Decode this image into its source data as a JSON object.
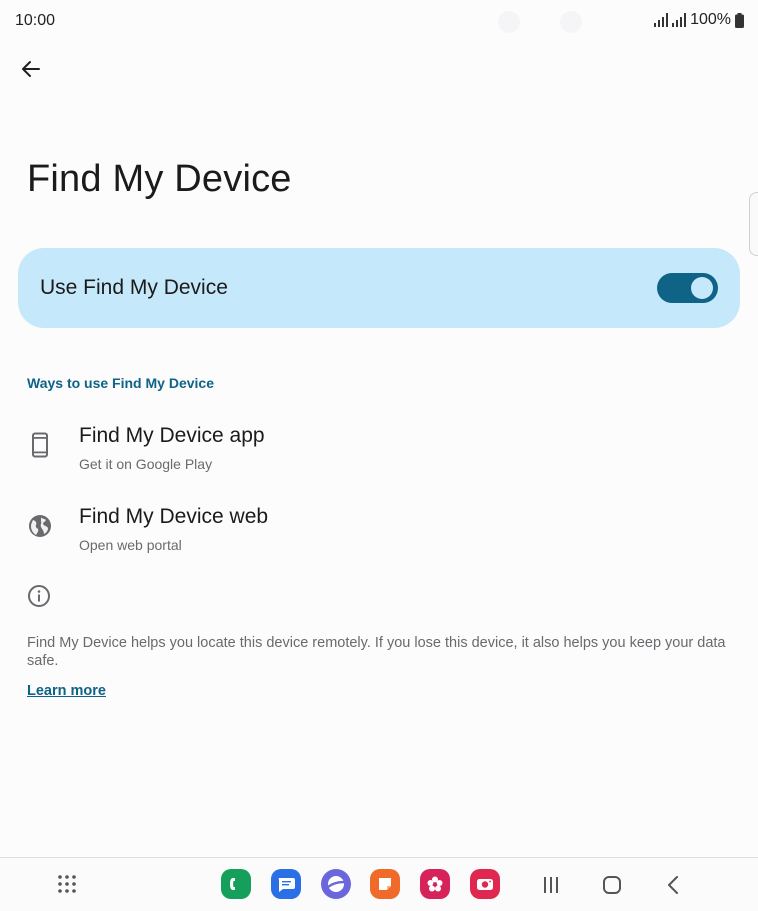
{
  "status_bar": {
    "time": "10:00",
    "battery": "100%",
    "icons": [
      "signal-icon",
      "signal-icon",
      "battery-icon"
    ]
  },
  "header": {
    "back_icon": "arrow-back-icon"
  },
  "page": {
    "title": "Find My Device"
  },
  "main_toggle": {
    "label": "Use Find My Device",
    "enabled": true
  },
  "section": {
    "header": "Ways to use Find My Device",
    "items": [
      {
        "icon": "phone-icon",
        "title": "Find My Device app",
        "subtitle": "Get it on Google Play"
      },
      {
        "icon": "globe-icon",
        "title": "Find My Device web",
        "subtitle": "Open web portal"
      }
    ]
  },
  "info": {
    "icon": "info-icon",
    "description": "Find My Device helps you locate this device remotely. If you lose this device, it also helps you keep your data safe.",
    "learn_more": "Learn more"
  },
  "nav_bar": {
    "apps_icon": "apps-grid-icon",
    "dock": [
      {
        "name": "phone-app-icon",
        "color": "#14a05a"
      },
      {
        "name": "messages-app-icon",
        "color": "#2a6fe6"
      },
      {
        "name": "internet-app-icon",
        "color": "#6b66dc"
      },
      {
        "name": "notes-app-icon",
        "color": "#f06a2a"
      },
      {
        "name": "gallery-app-icon",
        "color": "#d6235a"
      },
      {
        "name": "camera-app-icon",
        "color": "#e0274f"
      }
    ],
    "buttons": [
      "recents-icon",
      "home-icon",
      "back-nav-icon"
    ]
  },
  "colors": {
    "accent": "#0e6386",
    "toggle_card_bg": "#c6e8fb",
    "background": "#fcfcfd"
  }
}
